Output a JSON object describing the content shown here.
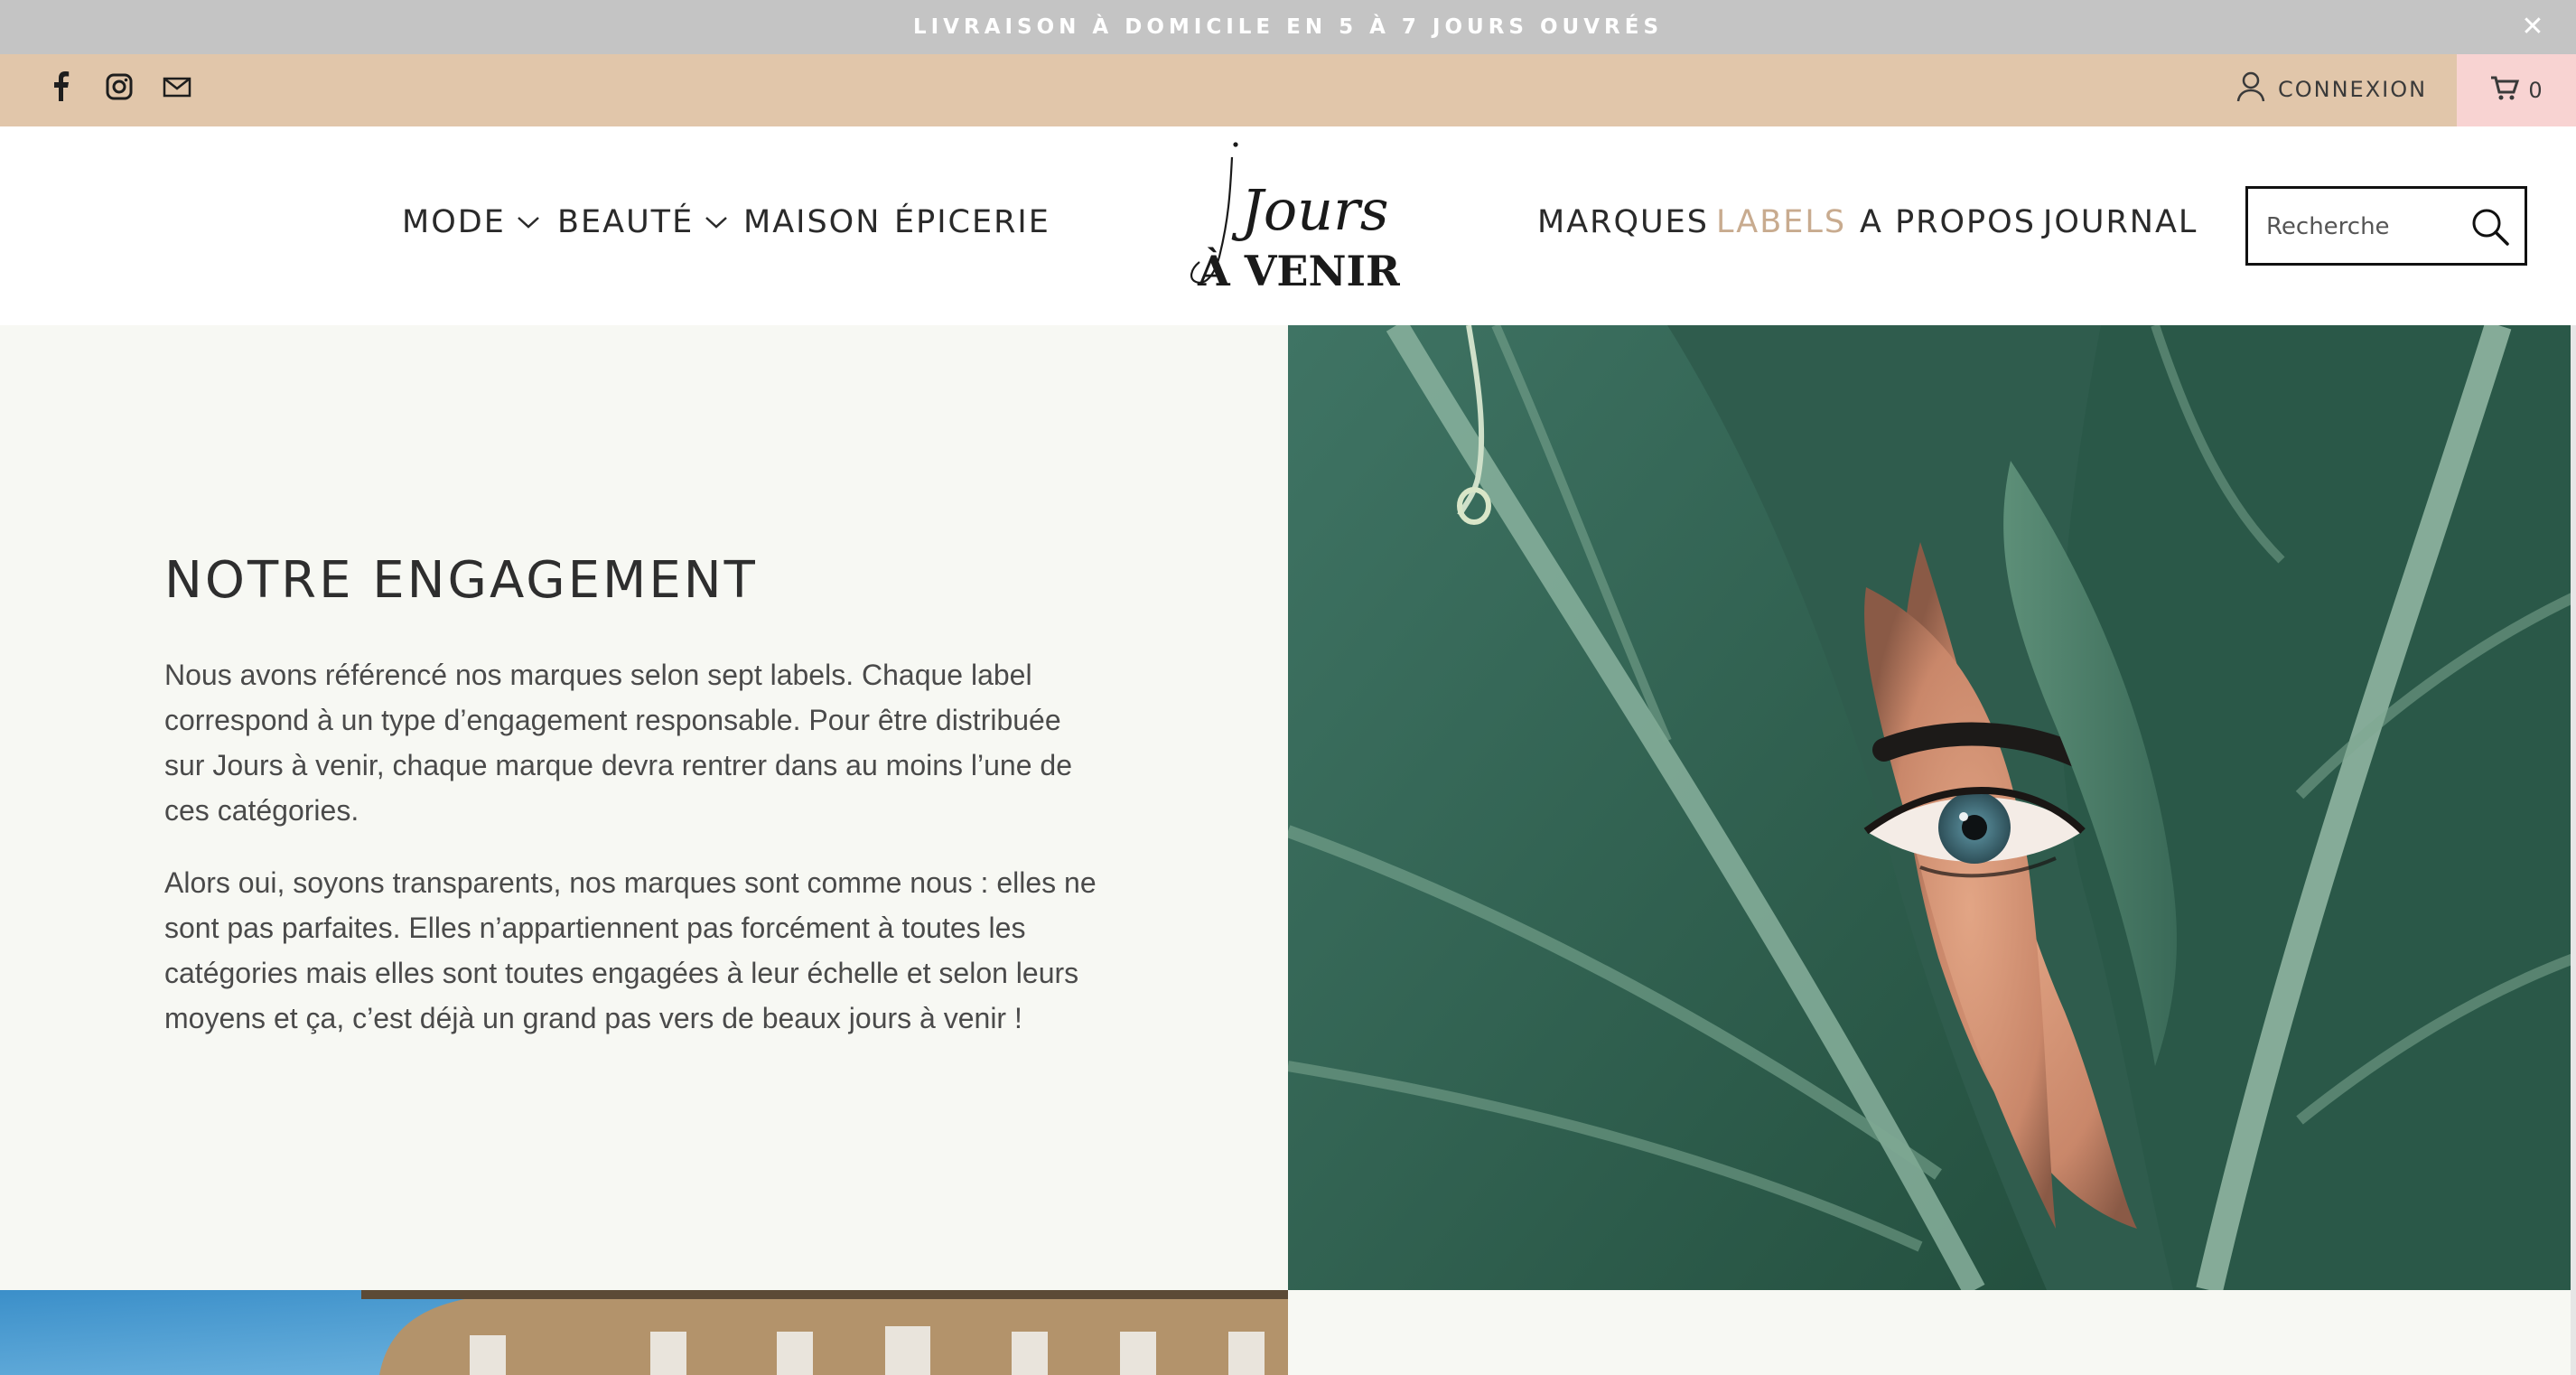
{
  "announcement": {
    "text": "LIVRAISON À DOMICILE EN 5 À 7 JOURS OUVRÉS",
    "close_label": "✕"
  },
  "topbar": {
    "social_icons": [
      "facebook-icon",
      "instagram-icon",
      "mail-icon"
    ],
    "login_label": "CONNEXION",
    "cart_count": "0"
  },
  "nav": {
    "left": [
      {
        "label": "MODE",
        "dropdown": true
      },
      {
        "label": "BEAUTÉ",
        "dropdown": true
      },
      {
        "label": "MAISON",
        "dropdown": false
      },
      {
        "label": "ÉPICERIE",
        "dropdown": false
      }
    ],
    "right": [
      {
        "label": "MARQUES",
        "active": false
      },
      {
        "label": "LABELS",
        "active": true
      },
      {
        "label": "A PROPOS",
        "active": false
      },
      {
        "label": "JOURNAL",
        "active": false
      }
    ]
  },
  "logo": {
    "line1": "Jours",
    "line2": "À VENIR"
  },
  "search": {
    "placeholder": "Recherche"
  },
  "main": {
    "heading": "NOTRE ENGAGEMENT",
    "paragraph1": "Nous avons référencé nos marques selon sept labels. Chaque label correspond à un type d’engagement responsable. Pour être distribuée sur Jours à venir, chaque marque devra rentrer dans au moins l’une de ces catégories.",
    "paragraph2": "Alors oui, soyons transparents, nos marques sont comme nous : elles ne sont pas parfaites. Elles n’appartiennent pas forcément à toutes les catégories mais elles sont toutes engagées à leur échelle et selon leurs moyens et ça, c’est déjà un grand pas vers de beaux jours à venir !"
  },
  "colors": {
    "announcement_bg": "#c4c4c4",
    "topbar_bg": "#e1c6aa",
    "cart_bg": "#f8d3d2",
    "active_nav": "#c8ab8f",
    "panel_bg": "#f7f8f3"
  }
}
